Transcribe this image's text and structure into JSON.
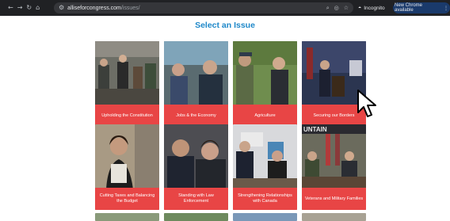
{
  "browser": {
    "url_site": "alliseforcongress.com",
    "url_path": "/issues/",
    "incognito_label": "Incognito",
    "update_label": "New Chrome available",
    "icons": [
      "back-icon",
      "forward-icon",
      "reload-icon",
      "home-icon",
      "site-settings-icon",
      "zoom-icon",
      "eye-slash-icon",
      "star-icon",
      "incognito-icon",
      "menu-icon"
    ]
  },
  "page": {
    "heading": "Select an Issue",
    "issues": [
      {
        "label": "Upholding the Constitution"
      },
      {
        "label": "Jobs & the Economy"
      },
      {
        "label": "Agriculture"
      },
      {
        "label": "Securing our Borders"
      },
      {
        "label": "Cutting Taxes and Balancing the Budget"
      },
      {
        "label": "Standing with Law Enforcement"
      },
      {
        "label": "Strengthening Relationships with Canada"
      },
      {
        "label": "Veterans and Military Families"
      }
    ],
    "card8_banner_text": "UNTAIN"
  },
  "colors": {
    "heading": "#1e88c9",
    "card_label_bg": "#e84545",
    "toolbar_bg": "#202124"
  }
}
